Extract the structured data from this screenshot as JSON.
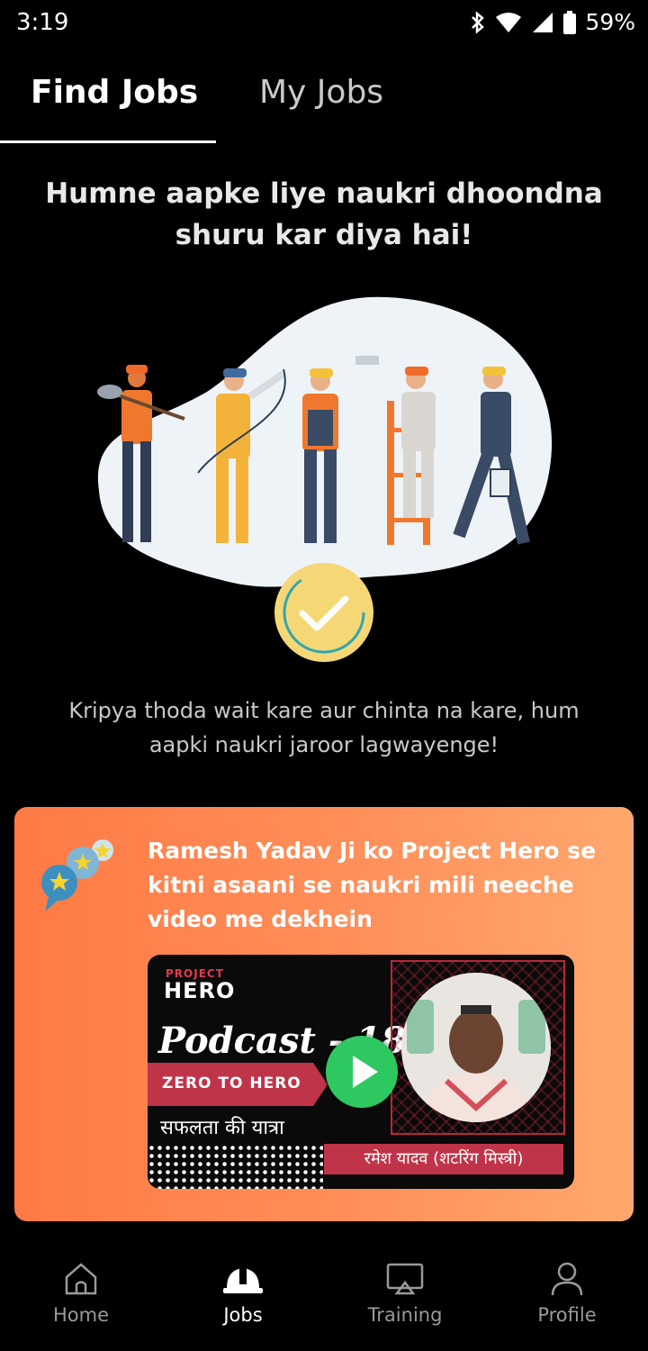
{
  "status_bar": {
    "time": "3:19",
    "battery": "59%"
  },
  "tabs": [
    {
      "label": "Find Jobs",
      "active": true
    },
    {
      "label": "My Jobs",
      "active": false
    }
  ],
  "headline": "Humne aapke liye naukri dhoondna shuru kar diya hai!",
  "wait_message": "Kripya thoda wait kare aur chinta na kare, hum aapki naukri jaroor lagwayenge!",
  "promo": {
    "text": "Ramesh Yadav Ji ko Project Hero se kitni asaani se naukri mili neeche video me dekhein",
    "icon": "stars-chat-icon",
    "video": {
      "brand_top": "PROJECT",
      "brand_main": "HERO",
      "title": "Podcast - 18",
      "banner": "ZERO TO HERO",
      "hindi_tagline": "सफलता की यात्रा",
      "person_name": "रमेश यादव (शटरिंग मिस्त्री)"
    }
  },
  "bottom_nav": [
    {
      "label": "Home",
      "icon": "home-icon",
      "active": false
    },
    {
      "label": "Jobs",
      "icon": "hard-hat-icon",
      "active": true
    },
    {
      "label": "Training",
      "icon": "screen-play-icon",
      "active": false
    },
    {
      "label": "Profile",
      "icon": "person-icon",
      "active": false
    }
  ],
  "colors": {
    "background": "#000000",
    "promo_gradient_start": "#ff7a44",
    "promo_gradient_end": "#ffa86e",
    "check_circle": "#f6d776",
    "play_button": "#2ec860",
    "accent_red": "#c0344a"
  }
}
